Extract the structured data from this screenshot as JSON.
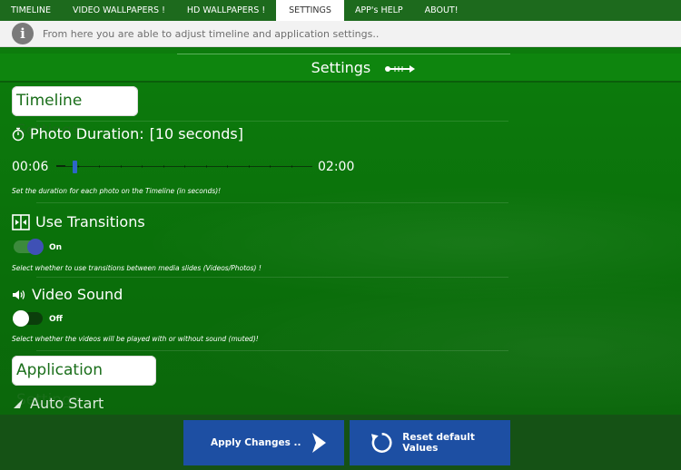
{
  "nav": {
    "tabs": [
      {
        "label": "TIMELINE",
        "active": false
      },
      {
        "label": "VIDEO WALLPAPERS !",
        "active": false
      },
      {
        "label": "HD WALLPAPERS !",
        "active": false
      },
      {
        "label": "SETTINGS",
        "active": true
      },
      {
        "label": "APP's HELP",
        "active": false
      },
      {
        "label": "ABOUT!",
        "active": false
      }
    ]
  },
  "info": {
    "icon": "info-icon",
    "text": "From here you are able to adjust timeline and application settings.."
  },
  "header": {
    "title": "Settings",
    "icon": "arrow-right-icon"
  },
  "timeline_settings": {
    "title": "Timeline Settings",
    "photo_duration": {
      "icon": "stopwatch-icon",
      "label": "Photo Duration:",
      "value": "[10 seconds]",
      "min_label": "00:06",
      "max_label": "02:00",
      "slider_fraction": 0.035,
      "description": "Set the duration for each photo on the Timeline (in seconds)!"
    },
    "transitions": {
      "icon": "transitions-icon",
      "label": "Use Transitions",
      "state": "On",
      "enabled": true,
      "description": "Select whether to use transitions between media slides (Videos/Photos) !"
    },
    "video_sound": {
      "icon": "speaker-icon",
      "label": "Video Sound",
      "state": "Off",
      "enabled": false,
      "description": "Select whether the videos will be played with or without sound (muted)!"
    }
  },
  "application_settings": {
    "title": "Application Settings",
    "partial_item": "Auto Start"
  },
  "actions": {
    "apply_label": "Apply Changes ..",
    "apply_icon": "chevron-right-icon",
    "reset_label": "Reset default Values",
    "reset_icon": "refresh-icon"
  },
  "colors": {
    "primary_green": "#0a6e0a",
    "button_blue": "#1d4fa3",
    "toggle_knob_on": "#3f51b5"
  }
}
